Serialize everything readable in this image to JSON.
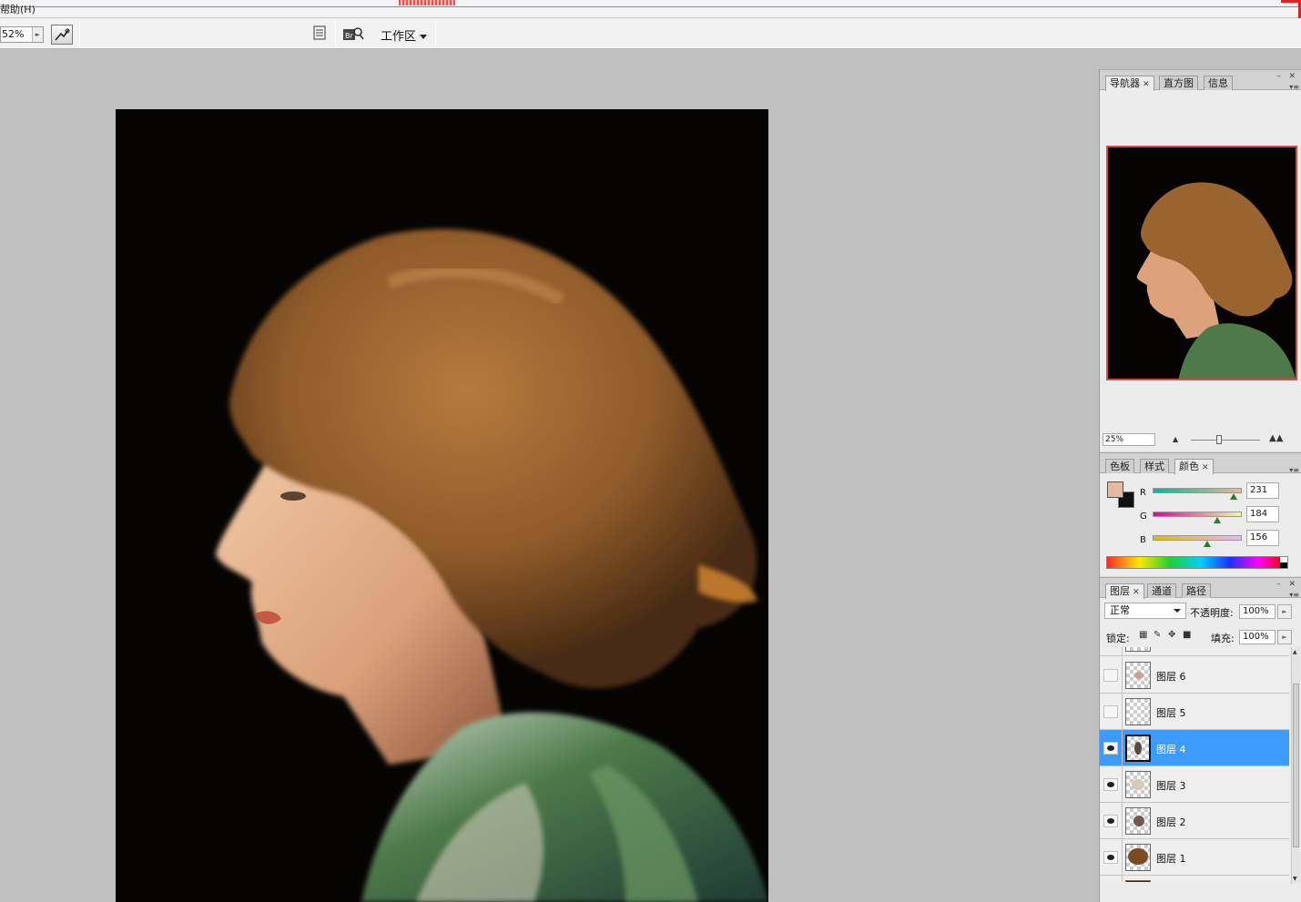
{
  "menu": {
    "help_label": "帮助(H)"
  },
  "options_bar": {
    "zoom_value": "52%",
    "workspace_label": "工作区"
  },
  "navigator_panel": {
    "tabs": [
      {
        "label": "导航器",
        "active": true,
        "closable": true
      },
      {
        "label": "直方图",
        "active": false,
        "closable": false
      },
      {
        "label": "信息",
        "active": false,
        "closable": false
      }
    ],
    "zoom_value": "25%"
  },
  "color_panel": {
    "tabs": [
      {
        "label": "色板",
        "active": false,
        "closable": false
      },
      {
        "label": "样式",
        "active": false,
        "closable": false
      },
      {
        "label": "颜色",
        "active": true,
        "closable": true
      }
    ],
    "foreground_color": "#e7b89c",
    "background_color": "#111111",
    "channels": [
      {
        "label": "R",
        "value": "231",
        "level": 0.906
      },
      {
        "label": "G",
        "value": "184",
        "level": 0.722
      },
      {
        "label": "B",
        "value": "156",
        "level": 0.612
      }
    ]
  },
  "layers_panel": {
    "tabs": [
      {
        "label": "图层",
        "active": true,
        "closable": true
      },
      {
        "label": "通道",
        "active": false,
        "closable": false
      },
      {
        "label": "路径",
        "active": false,
        "closable": false
      }
    ],
    "blend_mode": "正常",
    "opacity_label": "不透明度:",
    "opacity_value": "100%",
    "lock_label": "锁定:",
    "fill_label": "填充:",
    "fill_value": "100%",
    "layers": [
      {
        "name": "图层 6",
        "visible": false,
        "selected": false
      },
      {
        "name": "图层 5",
        "visible": false,
        "selected": false
      },
      {
        "name": "图层 4",
        "visible": true,
        "selected": true
      },
      {
        "name": "图层 3",
        "visible": true,
        "selected": false
      },
      {
        "name": "图层 2",
        "visible": true,
        "selected": false
      },
      {
        "name": "图层 1",
        "visible": true,
        "selected": false
      }
    ]
  }
}
